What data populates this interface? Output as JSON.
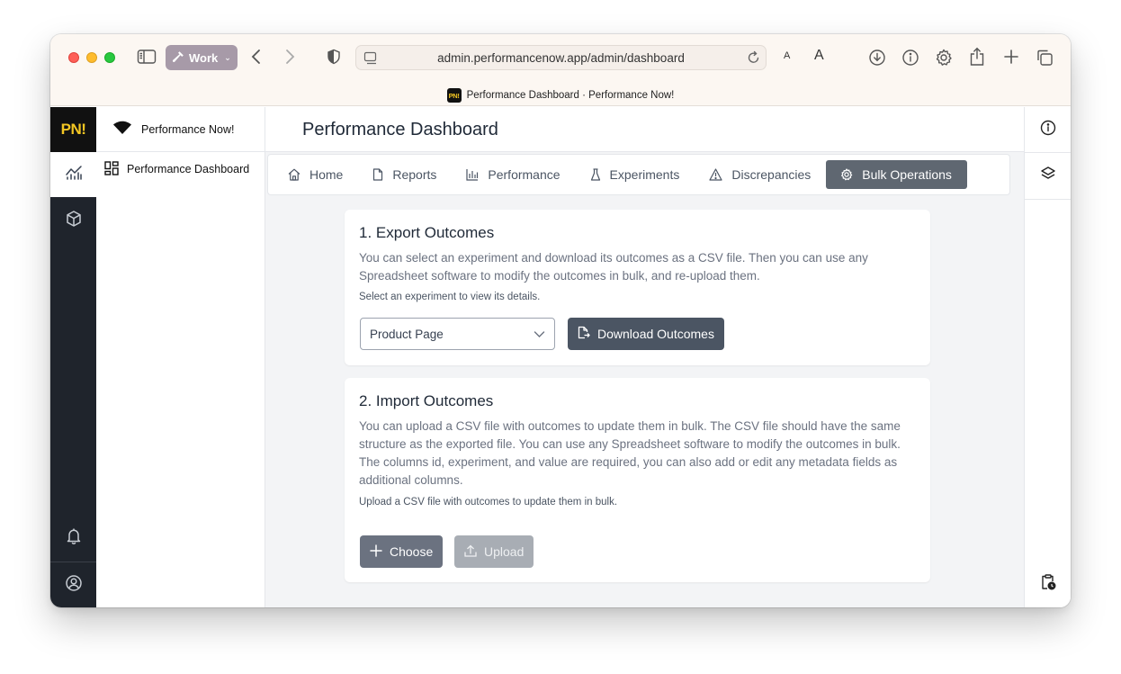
{
  "browser": {
    "profile_label": "Work",
    "url": "admin.performancenow.app/admin/dashboard",
    "tab_title": "Performance Dashboard · Performance Now!",
    "favicon_text": "PN!",
    "font_small": "A",
    "font_large": "A"
  },
  "app": {
    "logo_text": "PN!",
    "brand_name": "Performance Now!",
    "nav_item": "Performance Dashboard",
    "page_title": "Performance Dashboard",
    "accent_color": "#f3c623"
  },
  "tabs": [
    {
      "label": "Home",
      "icon": "home-icon"
    },
    {
      "label": "Reports",
      "icon": "file-icon"
    },
    {
      "label": "Performance",
      "icon": "bar-chart-icon"
    },
    {
      "label": "Experiments",
      "icon": "flask-icon"
    },
    {
      "label": "Discrepancies",
      "icon": "warning-icon"
    },
    {
      "label": "Bulk Operations",
      "icon": "gear-icon",
      "active": true
    }
  ],
  "export": {
    "title": "1. Export Outcomes",
    "description": "You can select an experiment and download its outcomes as a CSV file. Then you can use any Spreadsheet software to modify the outcomes in bulk, and re-upload them.",
    "hint": "Select an experiment to view its details.",
    "selected_experiment": "Product Page",
    "download_label": "Download Outcomes"
  },
  "import": {
    "title": "2. Import Outcomes",
    "description": "You can upload a CSV file with outcomes to update them in bulk. The CSV file should have the same structure as the exported file. You can use any Spreadsheet software to modify the outcomes in bulk. The columns id, experiment, and value are required, you can also add or edit any metadata fields as additional columns.",
    "hint": "Upload a CSV file with outcomes to update them in bulk.",
    "choose_label": "Choose",
    "upload_label": "Upload"
  }
}
